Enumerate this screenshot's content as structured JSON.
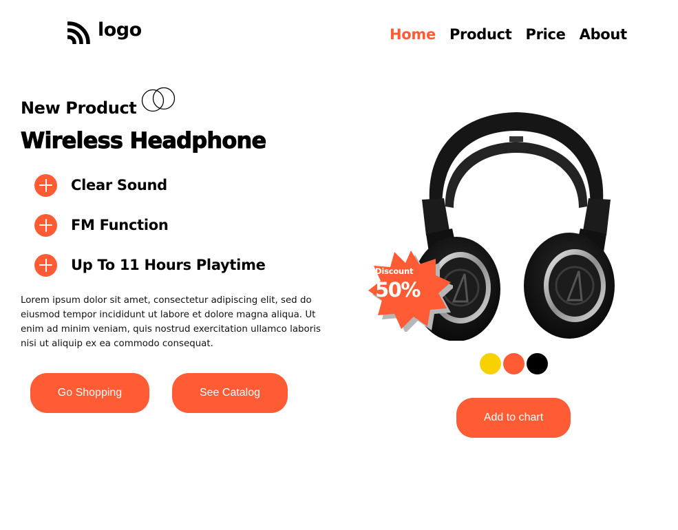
{
  "brand": {
    "logo_text": "logo",
    "logo_icon": "signal-arcs-icon"
  },
  "nav": {
    "items": [
      {
        "label": "Home",
        "active": true
      },
      {
        "label": "Product",
        "active": false
      },
      {
        "label": "Price",
        "active": false
      },
      {
        "label": "About",
        "active": false
      }
    ]
  },
  "hero": {
    "kicker": "New Product",
    "kicker_icon": "double-rings-icon",
    "title": "Wireless Headphone",
    "features": [
      {
        "label": "Clear Sound",
        "icon": "plus-circle-icon"
      },
      {
        "label": "FM Function",
        "icon": "plus-circle-icon"
      },
      {
        "label": "Up To 11 Hours Playtime",
        "icon": "plus-circle-icon"
      }
    ],
    "description": "Lorem ipsum dolor sit amet, consectetur adipiscing elit, sed do eiusmod tempor incididunt ut labore et dolore magna aliqua. Ut enim ad minim veniam, quis nostrud exercitation ullamco laboris nisi ut aliquip ex ea commodo consequat.",
    "buttons": {
      "primary": "Go Shopping",
      "secondary": "See Catalog"
    }
  },
  "product": {
    "image": "headphones-image",
    "badge": {
      "label": "Discount",
      "value": "50%"
    },
    "color_options": [
      "#f7d100",
      "#ff5c35",
      "#000000"
    ],
    "cart_button": "Add to chart"
  },
  "colors": {
    "accent": "#ff5c35",
    "text": "#000000",
    "background": "#ffffff"
  }
}
